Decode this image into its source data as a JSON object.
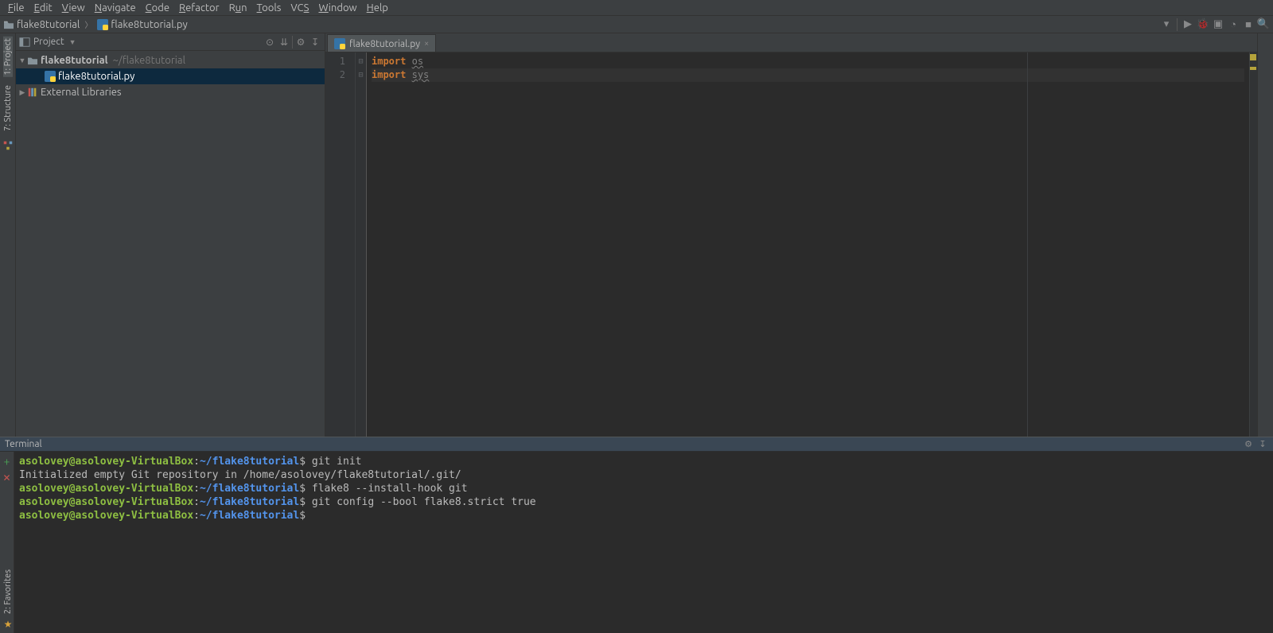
{
  "menu": [
    "File",
    "Edit",
    "View",
    "Navigate",
    "Code",
    "Refactor",
    "Run",
    "Tools",
    "VCS",
    "Window",
    "Help"
  ],
  "menu_hotkeys": [
    "F",
    "E",
    "V",
    "N",
    "C",
    "R",
    "u",
    "T",
    "S",
    "W",
    "H"
  ],
  "breadcrumb": {
    "project": "flake8tutorial",
    "file": "flake8tutorial.py"
  },
  "project_panel": {
    "title": "Project",
    "root": "flake8tutorial",
    "root_path": "~/flake8tutorial",
    "file": "flake8tutorial.py",
    "libs": "External Libraries"
  },
  "editor": {
    "tab": "flake8tutorial.py",
    "lines": [
      {
        "n": "1",
        "kw": "import",
        "mod": "os",
        "hl": false
      },
      {
        "n": "2",
        "kw": "import",
        "mod": "sys",
        "hl": true
      }
    ]
  },
  "terminal": {
    "title": "Terminal",
    "prompt": {
      "user": "asolovey@asolovey-VirtualBox",
      "sep": ":",
      "path": "~/flake8tutorial",
      "dollar": "$"
    },
    "lines": [
      {
        "type": "cmd",
        "text": "git init"
      },
      {
        "type": "out",
        "text": "Initialized empty Git repository in /home/asolovey/flake8tutorial/.git/"
      },
      {
        "type": "cmd",
        "text": "flake8 --install-hook git"
      },
      {
        "type": "cmd",
        "text": "git config --bool flake8.strict true"
      },
      {
        "type": "cmd",
        "text": ""
      }
    ]
  },
  "side_tabs": {
    "project": "1: Project",
    "structure": "7: Structure",
    "favorites": "2: Favorites"
  }
}
